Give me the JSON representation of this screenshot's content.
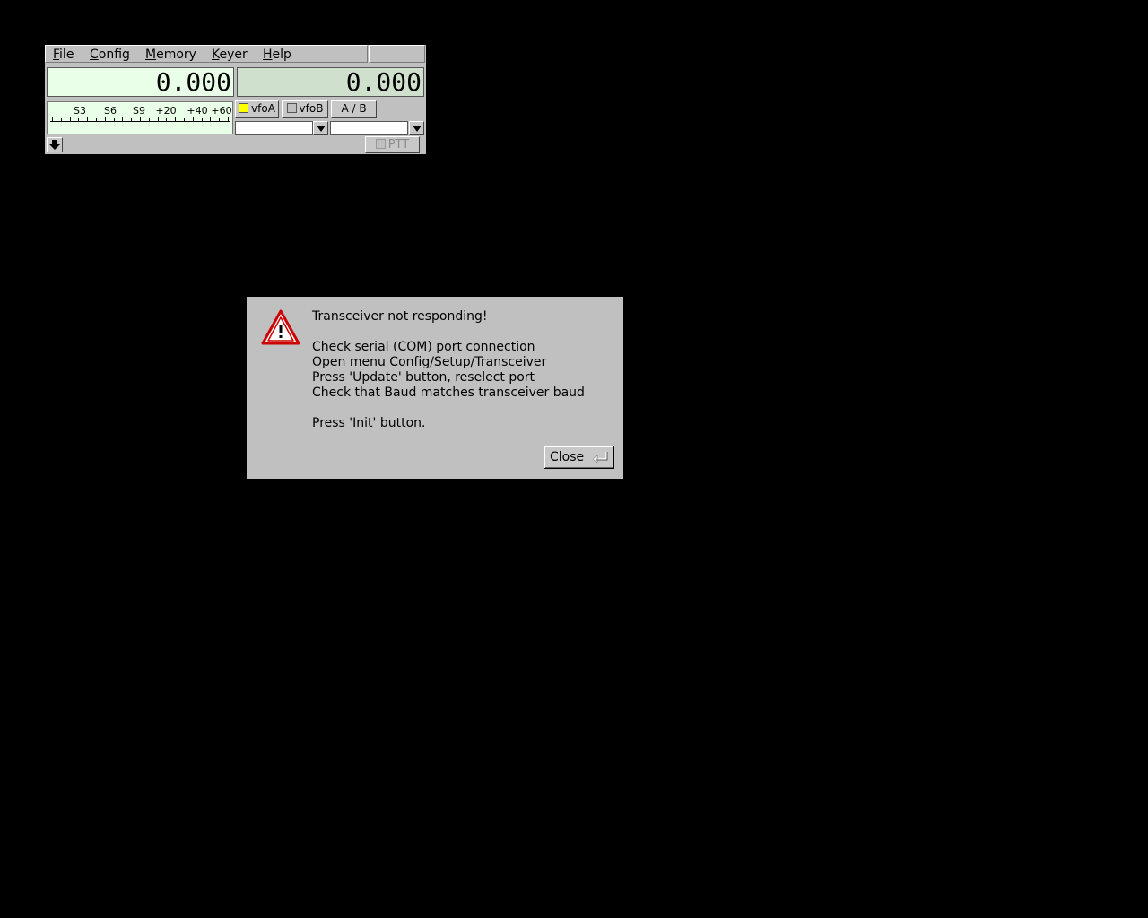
{
  "menu": {
    "items": [
      "File",
      "Config",
      "Memory",
      "Keyer",
      "Help"
    ]
  },
  "frequency": {
    "vfo_a": "0.000",
    "vfo_b": "0.000"
  },
  "smeter": {
    "labels": [
      "S3",
      "S6",
      "S9",
      "+20",
      "+40",
      "+60"
    ]
  },
  "vfo_buttons": {
    "vfo_a": "vfoA",
    "vfo_b": "vfoB",
    "ab": "A / B",
    "vfo_a_led_color": "#ffff00"
  },
  "ptt": {
    "label": "PTT"
  },
  "dialog": {
    "message": "Transceiver not responding!\n\nCheck serial (COM) port connection\nOpen menu Config/Setup/Transceiver\nPress 'Update' button, reselect port\nCheck that Baud matches transceiver baud\n\nPress 'Init' button.",
    "close_label": "Close",
    "icon": "warning-icon"
  }
}
